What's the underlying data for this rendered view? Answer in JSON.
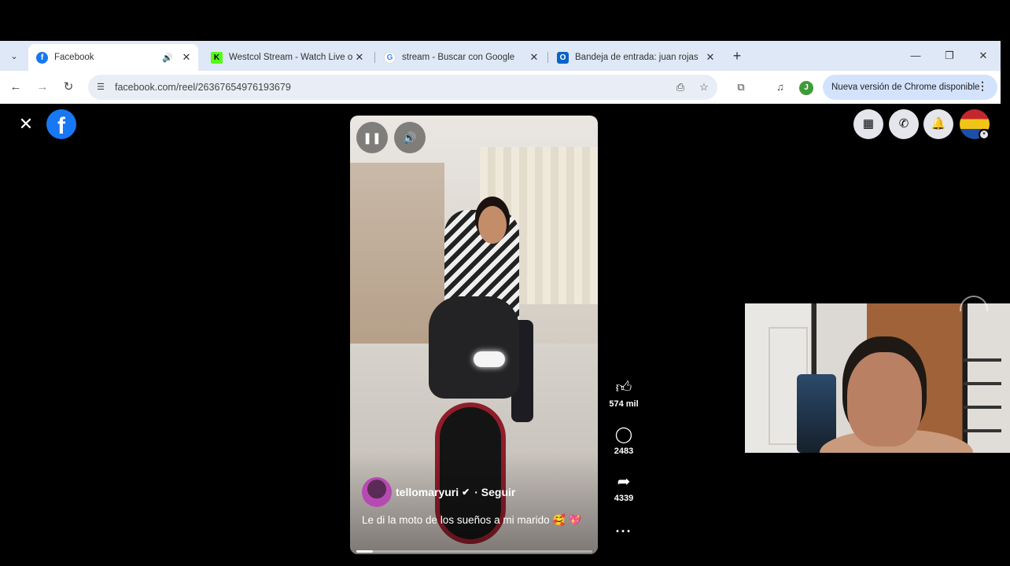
{
  "browser": {
    "tabs": [
      {
        "title": "Facebook",
        "favicon": "facebook-favicon",
        "active": true,
        "audio": true
      },
      {
        "title": "Westcol Stream - Watch Live on",
        "favicon": "kick-favicon",
        "active": false
      },
      {
        "title": "stream - Buscar con Google",
        "favicon": "google-favicon",
        "active": false
      },
      {
        "title": "Bandeja de entrada: juan rojas",
        "favicon": "outlook-favicon",
        "active": false
      }
    ],
    "url": "facebook.com/reel/26367654976193679",
    "profile_initial": "J",
    "update_label": "Nueva versión de Chrome disponible"
  },
  "facebook": {
    "logo": "f"
  },
  "reel": {
    "author": "tellomaryuri",
    "follow_label": "Seguir",
    "caption": "Le di la moto de los sueños a mi marido 🥰 💖",
    "progress": 0.07
  },
  "actions": {
    "likes": "574 mil",
    "comments": "2483",
    "shares": "4339"
  },
  "colors": {
    "facebook_blue": "#1877f2",
    "chrome_tabstrip": "#dfe8f6",
    "update_pill": "#d3e3fd"
  }
}
